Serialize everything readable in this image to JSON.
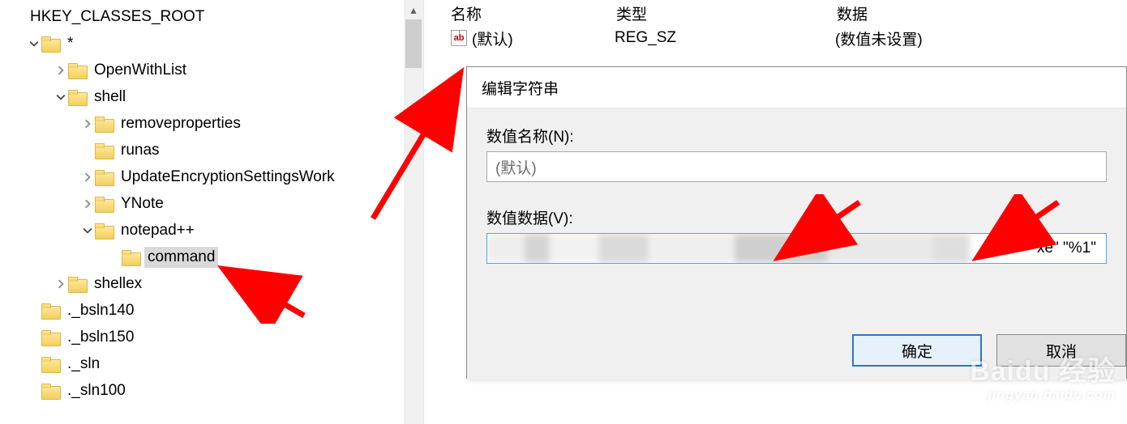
{
  "tree": {
    "root": "HKEY_CLASSES_ROOT",
    "star": "*",
    "openwith": "OpenWithList",
    "shell": "shell",
    "removeprops": "removeproperties",
    "runas": "runas",
    "update": "UpdateEncryptionSettingsWork",
    "ynote": "YNote",
    "npp": "notepad++",
    "command": "command",
    "shellex": "shellex",
    "bsln140": "._bsln140",
    "bsln150": "._bsln150",
    "sln": "._sln",
    "sln100": "._sln100"
  },
  "list": {
    "col_name": "名称",
    "col_type": "类型",
    "col_data": "数据",
    "default_name": "(默认)",
    "default_type": "REG_SZ",
    "default_data": "(数值未设置)",
    "icon_text": "ab"
  },
  "dialog": {
    "title": "编辑字符串",
    "name_label": "数值名称(N):",
    "name_value": "(默认)",
    "data_label": "数值数据(V):",
    "data_tail": "xe\" \"%1\"",
    "ok": "确定",
    "cancel": "取消"
  },
  "watermark": {
    "line1": "Baidu 经验",
    "line2": "jingyan.baidu.com"
  }
}
